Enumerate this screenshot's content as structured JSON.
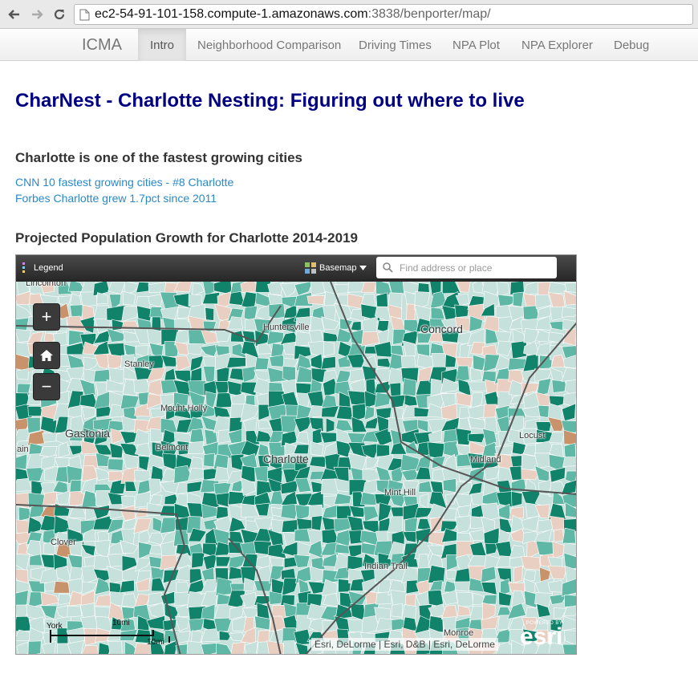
{
  "browser": {
    "url_host": "ec2-54-91-101-158.compute-1.amazonaws.com",
    "url_rest": ":3838/benporter/map/"
  },
  "nav": {
    "brand": "ICMA",
    "tabs": [
      {
        "label": "Intro",
        "active": true
      },
      {
        "label": "Neighborhood Comparison",
        "active": false
      },
      {
        "label": "Driving Times",
        "active": false
      },
      {
        "label": "NPA Plot",
        "active": false
      },
      {
        "label": "NPA Explorer",
        "active": false
      },
      {
        "label": "Debug",
        "active": false
      }
    ]
  },
  "page": {
    "title": "CharNest - Charlotte Nesting: Figuring out where to live",
    "section_heading": "Charlotte is one of the fastest growing cities",
    "links": [
      "CNN 10 fastest growing cities - #8 Charlotte",
      "Forbes Charlotte grew 1.7pct since 2011"
    ],
    "map_heading": "Projected Population Growth for Charlotte 2014-2019"
  },
  "map": {
    "legend_label": "Legend",
    "basemap_label": "Basemap",
    "search_placeholder": "Find address or place",
    "zoom_in": "+",
    "zoom_out": "−",
    "places": [
      "Lincolnton",
      "Huntersville",
      "Concord",
      "Stanley",
      "Mount Holly",
      "Gastonia",
      "Belmont",
      "ain",
      "Charlotte",
      "Locust",
      "Midland",
      "Mint Hill",
      "Clover",
      "Indian Trail",
      "York",
      "Monroe"
    ],
    "scale_labels": {
      "top": "10mi",
      "bottom": "10mi"
    },
    "attribution": "Esri, DeLorme | Esri, D&B | Esri, DeLorme",
    "powered_by": "POWERED BY",
    "esri": "esri",
    "colors": {
      "light": "#c6e0db",
      "mid": "#5fb8a5",
      "dark": "#11836b",
      "tan": "#e8cfc2",
      "brown": "#c8936b",
      "border": "#555555"
    }
  }
}
